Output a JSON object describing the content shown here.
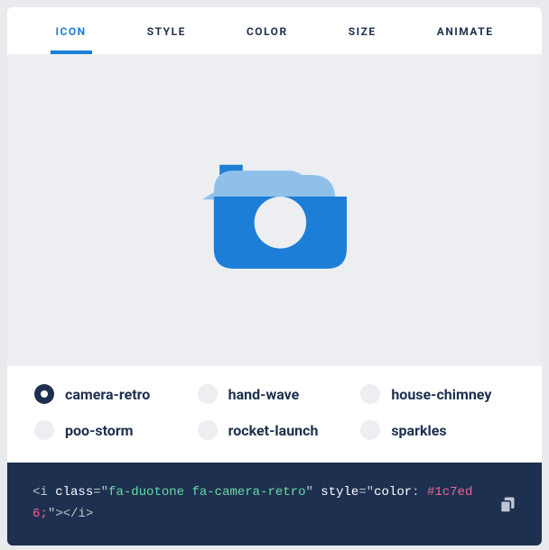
{
  "tabs": {
    "items": [
      "ICON",
      "STYLE",
      "COLOR",
      "SIZE",
      "ANIMATE"
    ],
    "active": 0
  },
  "preview": {
    "icon_name": "camera-retro",
    "color_primary": "#1c7ed6",
    "color_secondary": "#8fc0ea"
  },
  "options": [
    {
      "label": "camera-retro",
      "selected": true
    },
    {
      "label": "hand-wave",
      "selected": false
    },
    {
      "label": "house-chimney",
      "selected": false
    },
    {
      "label": "poo-storm",
      "selected": false
    },
    {
      "label": "rocket-launch",
      "selected": false
    },
    {
      "label": "sparkles",
      "selected": false
    }
  ],
  "code": {
    "open": "<i ",
    "attr1": "class",
    "eq": "=\"",
    "val1": "fa-duotone fa-camera-retro",
    "mid": "\" ",
    "attr2": "style",
    "val2p": "color",
    "colon": ": ",
    "val2v": "#1c7ed6;",
    "close": "\"></i>"
  }
}
